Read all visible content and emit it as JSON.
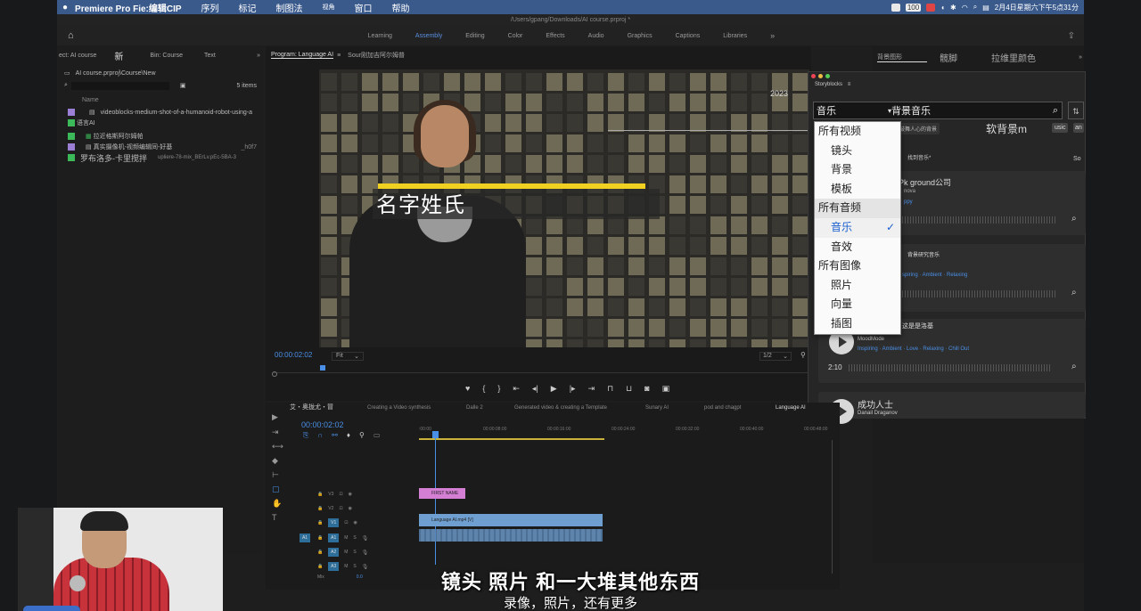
{
  "menubar": {
    "app": "Premiere Pro Fie:编辑CIP",
    "items": [
      "序列",
      "标记",
      "制图法",
      "视角",
      "窗口",
      "帮助"
    ],
    "clock": "2月4日星期六下午5点31分",
    "battery": "100"
  },
  "window": {
    "title": "/Users/gpang/Downloads/AI course.prproj *"
  },
  "workspaces": [
    "Learning",
    "Assembly",
    "Editing",
    "Color",
    "Effects",
    "Audio",
    "Graphics",
    "Captions",
    "Libraries"
  ],
  "project": {
    "tabs": [
      "ect: AI course",
      "新",
      "Bin: Course",
      "Text"
    ],
    "path": "AI course.prproj\\Course\\New",
    "items_count": "5 items",
    "col_header": "Name",
    "items": [
      {
        "label": "videoblocks-medium-shot-of-a-humanoid-robot-using-a",
        "color": "#9b7fd4"
      },
      {
        "label": "语言AI",
        "color": "#3cba5a"
      },
      {
        "label": "拉近格斯阿尔姆帕",
        "color": "#3cba5a"
      },
      {
        "label": "真实摄像机-视频编辑同-好基",
        "color": "#9b7fd4"
      },
      {
        "label": "罗布洛多-卡里搅拌",
        "color": "#3cba5a"
      }
    ],
    "item4_extra": "_h0f7",
    "item5_extra": "upliere-78-mix_BErLv.pEc-5BA-3"
  },
  "program": {
    "tab": "Program: Language AI",
    "tab2": "Sour",
    "tab3": "刚加吉阿尔姆普",
    "timecode": "00:00:02:02",
    "fit": "Fit",
    "page": "1/2",
    "year": "2023",
    "lower_third": "名字姓氏"
  },
  "transport": [
    "♥",
    "{",
    "}",
    "⇤",
    "◂|",
    "▶",
    "|▸",
    "⇥"
  ],
  "eg": {
    "tabs": [
      "背景图形",
      "髋脚",
      "拉维里颜色"
    ]
  },
  "storyblocks": {
    "title": "Storyblocks",
    "category": "音乐",
    "search": "背景音乐",
    "chip1": "鼓舞人心的背景",
    "chip2": "软背景m",
    "chip3": "usic",
    "chip4": "an",
    "sort": "So",
    "tracks": [
      {
        "title": "找到音乐*",
        "artist": "",
        "tags": ""
      },
      {
        "title": "Pk ground公司",
        "artist": "nova",
        "tags": "ppy",
        "duration": ""
      },
      {
        "title": "背景研究音乐",
        "artist": "",
        "tags": "spiring · Ambient · Relaxing",
        "duration": ""
      },
      {
        "title": "这是是洛基",
        "artist": "MoodMode",
        "tags": "Inspiring · Ambient · Love · Relaxing · Chill Out",
        "duration": "2:10"
      },
      {
        "title": "成功人士",
        "artist": "Danail Draganov",
        "tags": "",
        "duration": ""
      }
    ]
  },
  "dropdown": {
    "items": [
      {
        "label": "所有视频",
        "type": "header"
      },
      {
        "label": "镜头",
        "type": "sub"
      },
      {
        "label": "背景",
        "type": "sub"
      },
      {
        "label": "模板",
        "type": "sub"
      },
      {
        "label": "所有音频",
        "type": "header"
      },
      {
        "label": "音乐",
        "type": "sub",
        "selected": true
      },
      {
        "label": "音效",
        "type": "sub"
      },
      {
        "label": "所有图像",
        "type": "header"
      },
      {
        "label": "照片",
        "type": "sub"
      },
      {
        "label": "向量",
        "type": "sub"
      },
      {
        "label": "插图",
        "type": "sub"
      }
    ],
    "check": "✓"
  },
  "timeline": {
    "sequence": "艾・奥拢尤・冒",
    "timecode": "00:00:02:02",
    "tabs": [
      "Creating a Video synthesis",
      "Dalle 2",
      "Generated video & creating a Template",
      "Sunary AI",
      "pod and chagpt",
      "Language AI"
    ],
    "ruler": [
      ":00:00",
      "00:00:08:00",
      "00:00:16:00",
      "00:00:24:00",
      "00:00:32:00",
      "00:00:40:00",
      "00:00:48:00"
    ],
    "video_tracks": [
      "V3",
      "V2",
      "V1"
    ],
    "audio_tracks": [
      "A1",
      "A2",
      "A3"
    ],
    "src_track": "A1",
    "mix": "Mix",
    "mix_val": "0.0",
    "clip_title": "FIRST NAME",
    "clip_video": "Language AI.mp4 [V]"
  },
  "subtitles": {
    "line1": "镜头 照片 和一大堆其他东西",
    "line2": "录像，照片，还有更多"
  },
  "colors": {
    "accent": "#4a8fe6",
    "title_bar": "#f0d020",
    "purple": "#9b7fd4",
    "green": "#3cba5a",
    "track_blue": "#2d6e9a",
    "clip_pink": "#d47fd4",
    "clip_blue": "#6f9fd0"
  }
}
